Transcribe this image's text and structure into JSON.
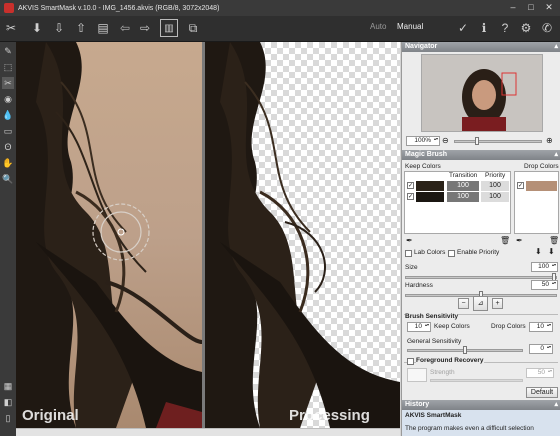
{
  "titlebar": {
    "title": "AKVIS SmartMask v.10.0 - IMG_1456.akvis (RGB/8, 3072x2048)"
  },
  "toolbar": {
    "modes": {
      "auto": "Auto",
      "manual": "Manual"
    },
    "icons": [
      "scissors-icon",
      "open-icon",
      "save-icon",
      "publish-icon",
      "print-icon",
      "undo-icon",
      "redo-icon",
      "split-view-icon",
      "layers-view-icon",
      "apply-icon",
      "info-icon",
      "help-icon",
      "settings-icon",
      "tutorial-icon"
    ]
  },
  "canvas": {
    "left_label": "Original",
    "right_label": "Processing"
  },
  "navigator": {
    "title": "Navigator",
    "zoom": "100%"
  },
  "magic_brush": {
    "title": "Magic Brush",
    "keep_colors": "Keep Colors",
    "drop_colors": "Drop Colors",
    "col_transition": "Transition",
    "col_priority": "Priority",
    "rows": [
      {
        "checked": true,
        "color": "#2a2218",
        "transition": "100",
        "priority": "100"
      },
      {
        "checked": true,
        "color": "#1b1712",
        "transition": "100",
        "priority": "100"
      }
    ],
    "drop_row": {
      "checked": true,
      "color": "#b59077"
    },
    "lab_colors": "Lab Colors",
    "enable_priority": "Enable Priority",
    "size_label": "Size",
    "size_value": "100",
    "size_fraction": 1.0,
    "hardness_label": "Hardness",
    "hardness_value": "50",
    "hardness_fraction": 0.5,
    "brush_sensitivity": "Brush Sensitivity",
    "keep_sens_value": "10",
    "drop_sens_value": "10",
    "general_sensitivity": "General Sensitivity",
    "general_value": "0",
    "foreground_recovery": "Foreground Recovery",
    "strength": "Strength",
    "strength_value": "50",
    "default": "Default"
  },
  "history": {
    "title": "History",
    "subtitle": "AKVIS SmartMask",
    "text": "The program makes even a difficult selection"
  }
}
